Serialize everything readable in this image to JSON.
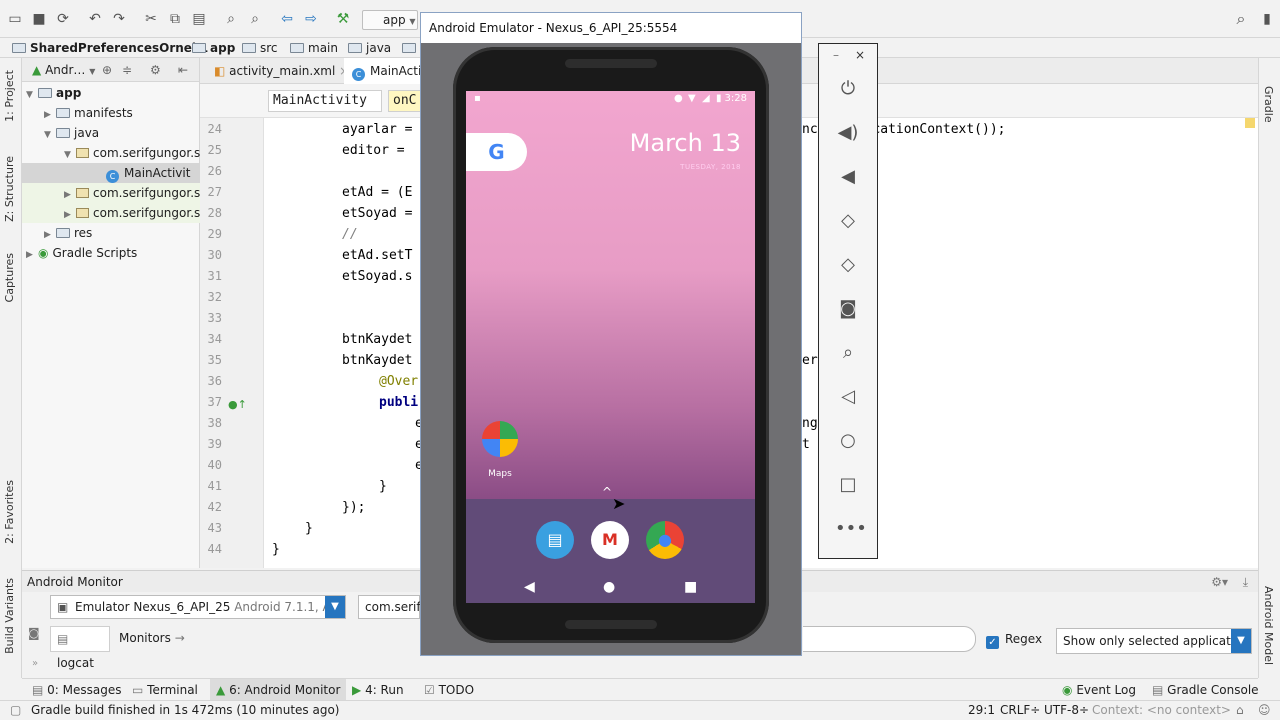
{
  "toolbar": {
    "run_config": "app"
  },
  "nav": {
    "project": "SharedPreferencesOrnek1",
    "crumbs": [
      "app",
      "src",
      "main",
      "java"
    ]
  },
  "left_tools": [
    "1: Project",
    "Z: Structure",
    "Captures",
    "2: Favorites",
    "Build Variants"
  ],
  "right_tools": [
    "Gradle",
    "Android Model"
  ],
  "project_panel": {
    "view": "Andr…",
    "tree": [
      {
        "label": "app",
        "level": 0
      },
      {
        "label": "manifests",
        "level": 1
      },
      {
        "label": "java",
        "level": 1
      },
      {
        "label": "com.serifgungor.s",
        "level": 2
      },
      {
        "label": "MainActivit",
        "level": 3
      },
      {
        "label": "com.serifgungor.s",
        "level": 2
      },
      {
        "label": "com.serifgungor.s",
        "level": 2
      },
      {
        "label": "res",
        "level": 1
      },
      {
        "label": "Gradle Scripts",
        "level": 0
      }
    ]
  },
  "editor": {
    "tabs": [
      "activity_main.xml",
      "MainActiv"
    ],
    "crumb_class": "MainActivity",
    "crumb_method": "onC",
    "line_numbers": [
      "24",
      "25",
      "26",
      "27",
      "28",
      "29",
      "30",
      "31",
      "32",
      "33",
      "34",
      "35",
      "36",
      "37",
      "38",
      "39",
      "40",
      "41",
      "42",
      "43",
      "44"
    ],
    "lines": [
      "ayarlar =",
      "editor =",
      "",
      "etAd = (E",
      "etSoyad =",
      "//",
      "etAd.setT",
      "etSoyad.s",
      "",
      "",
      "btnKaydet",
      "btnKaydet",
      "@Over",
      "publi",
      "e",
      "e",
      "e",
      "}",
      "});",
      "}",
      "}"
    ],
    "right_fragments": {
      "l24": "nc  ApplicationContext());",
      "l35": "er",
      "l38": "ng",
      "l39": "t  ());"
    }
  },
  "monitor": {
    "title": "Android Monitor",
    "device": "Emulator Nexus_6_API_25",
    "device_detail": "Android 7.1.1, API 25",
    "process": "com.serifg",
    "tabs": [
      "logcat",
      "Monitors"
    ],
    "regex_label": "Regex",
    "filter": "Show only selected application"
  },
  "bottom_tools": {
    "messages": "0: Messages",
    "terminal": "Terminal",
    "android_monitor": "6: Android Monitor",
    "run": "4: Run",
    "todo": "TODO",
    "event_log": "Event Log",
    "gradle_console": "Gradle Console"
  },
  "status": {
    "message": "Gradle build finished in 1s 472ms (10 minutes ago)",
    "position": "29:1",
    "line_sep": "CRLF÷",
    "encoding": "UTF-8÷",
    "context": "Context: <no context>"
  },
  "emulator": {
    "title": "Android Emulator - Nexus_6_API_25:5554",
    "time": "3:28",
    "date_big": "March 13",
    "date_small": "TUESDAY, 2018",
    "google_letter": "G",
    "maps_label": "Maps",
    "dock": [
      "messages-icon",
      "gmail-icon",
      "chrome-icon"
    ]
  }
}
